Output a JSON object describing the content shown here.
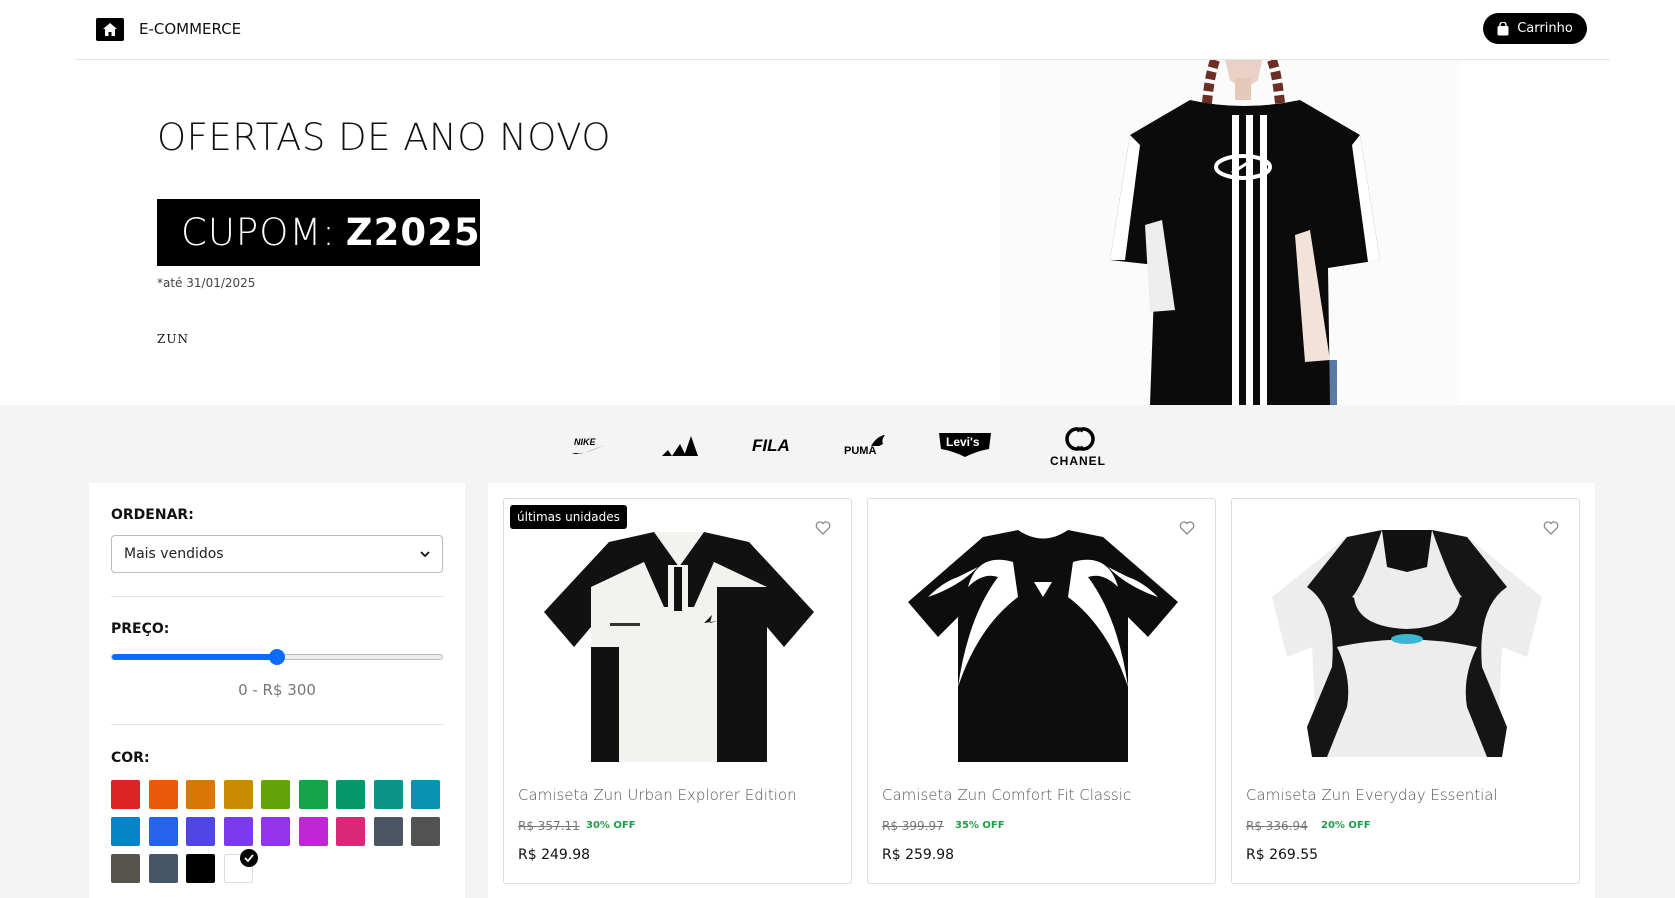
{
  "header": {
    "brand": "E-COMMERCE",
    "cart_label": "Carrinho"
  },
  "hero": {
    "title": "OFERTAS DE ANO NOVO",
    "coupon_prefix": "CUPOM:",
    "coupon_code": "Z2025",
    "coupon_note": "*até 31/01/2025",
    "brand": "ZUN"
  },
  "brands": [
    "NIKE",
    "adidas",
    "FILA",
    "PUMA",
    "Levi's",
    "CHANEL"
  ],
  "filters": {
    "sort_label": "ORDENAR:",
    "sort_value": "Mais vendidos",
    "price_label": "PREÇO:",
    "price_range": "0 - R$ 300",
    "price_slider_fraction": 0.5,
    "color_label": "COR:",
    "colors": [
      "#dc2626",
      "#ea580c",
      "#d97706",
      "#ca8a04",
      "#65a30d",
      "#16a34a",
      "#059669",
      "#0d9488",
      "#0891b2",
      "#0284c7",
      "#2563eb",
      "#4f46e5",
      "#7c3aed",
      "#9333ea",
      "#c026d3",
      "#db2777",
      "#4b5563",
      "#525252",
      "#57534e",
      "#475569",
      "#000000",
      "#ffffff"
    ],
    "selected_color": "#ffffff"
  },
  "products": [
    {
      "name": "Camiseta Zun Urban Explorer Edition",
      "old_price": "R$ 357.11",
      "discount": "30% OFF",
      "price": "R$ 249.98",
      "badge": "últimas unidades"
    },
    {
      "name": "Camiseta Zun Comfort Fit Classic",
      "old_price": "R$ 399.97",
      "discount": "35% OFF",
      "price": "R$ 259.98",
      "badge": ""
    },
    {
      "name": "Camiseta Zun Everyday Essential",
      "old_price": "R$ 336.94",
      "discount": "20% OFF",
      "price": "R$ 269.55",
      "badge": ""
    }
  ]
}
